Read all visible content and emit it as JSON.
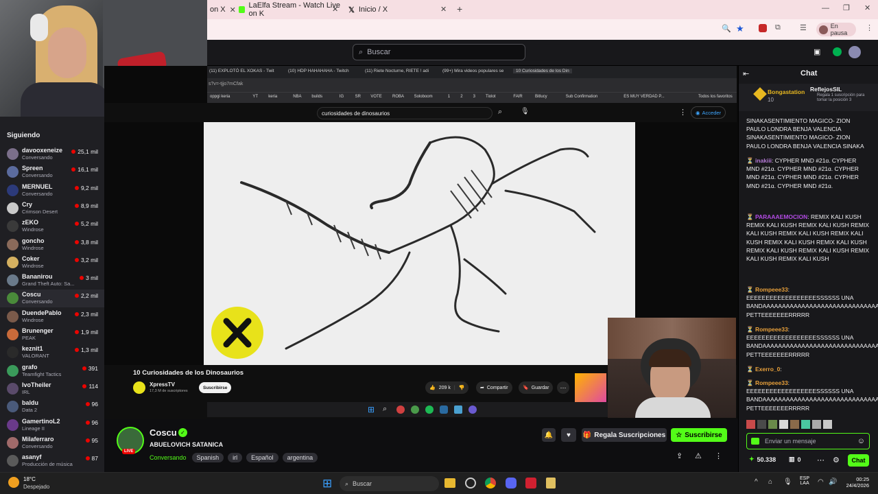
{
  "browser": {
    "tabs": [
      {
        "label": "on X"
      },
      {
        "label": "LaElfa Stream - Watch Live on K"
      },
      {
        "label": "Inicio / X"
      }
    ],
    "profile_label": "En pausa"
  },
  "twitch": {
    "search_placeholder": "Buscar",
    "sidebar_heading": "Siguiendo",
    "followed": [
      {
        "name": "davooxeneize",
        "game": "Conversando",
        "viewers": "25,1 mil",
        "color": "#7b6f8a"
      },
      {
        "name": "Spreen",
        "game": "Conversando",
        "viewers": "16,1 mil",
        "color": "#5b6b9e"
      },
      {
        "name": "MERNUEL",
        "game": "Conversando",
        "viewers": "9,2 mil",
        "color": "#2c3a7a"
      },
      {
        "name": "Cry",
        "game": "Crimson Desert",
        "viewers": "8,9 mil",
        "color": "#c9c9c9"
      },
      {
        "name": "zEKO",
        "game": "Windrose",
        "viewers": "5,2 mil",
        "color": "#3a3a3a"
      },
      {
        "name": "goncho",
        "game": "Windrose",
        "viewers": "3,8 mil",
        "color": "#8a6a5a"
      },
      {
        "name": "Coker",
        "game": "Windrose",
        "viewers": "3,2 mil",
        "color": "#d4b060"
      },
      {
        "name": "Bananirou",
        "game": "Grand Theft Auto: Sa...",
        "viewers": "3 mil",
        "color": "#6a7a8a"
      },
      {
        "name": "Coscu",
        "game": "Conversando",
        "viewers": "2,2 mil",
        "color": "#4a8a3a"
      },
      {
        "name": "DuendePablo",
        "game": "Windrose",
        "viewers": "2,3 mil",
        "color": "#7a5a4a"
      },
      {
        "name": "Brunenger",
        "game": "PEAK",
        "viewers": "1,9 mil",
        "color": "#c86a3a"
      },
      {
        "name": "keznit1",
        "game": "VALORANT",
        "viewers": "1,3 mil",
        "color": "#2a2a2a"
      },
      {
        "name": "grafo",
        "game": "Teamfight Tactics",
        "viewers": "391",
        "color": "#3a9a5a"
      },
      {
        "name": "IvoTheiler",
        "game": "IRL",
        "viewers": "114",
        "color": "#5a4a6a"
      },
      {
        "name": "baldu",
        "game": "Data 2",
        "viewers": "96",
        "color": "#4a5a7a"
      },
      {
        "name": "GamertinoL2",
        "game": "Lineage II",
        "viewers": "96",
        "color": "#6a3a8a"
      },
      {
        "name": "Milaferraro",
        "game": "Conversando",
        "viewers": "95",
        "color": "#a06a6a"
      },
      {
        "name": "asanyf",
        "game": "Producción de música",
        "viewers": "87",
        "color": "#5a5a5a"
      }
    ]
  },
  "stream": {
    "inner_tabs": [
      "(11) EXPLOTÓ EL XOKAS - Twit",
      "(10) HDP HAHAHAHA - Twitch",
      "(11) Riete Nocturne, RIETE ! adi",
      "(99+) Mira videos populares se",
      "10 Curiosidades de los Din"
    ],
    "inner_url": "s?v=-tjjo7mCfak",
    "bookmarks": [
      "oppgi keria",
      "YT",
      "keria",
      "NBA",
      "builds",
      "IG",
      "SR",
      "VOTE",
      "ROBA",
      "Soloboom",
      "1",
      "2",
      "3",
      "Tiolot",
      "FAIR",
      "Bitlucy",
      "Sub Confirmation",
      "ES MUY VERDAD P...",
      "Todos los favoritos"
    ],
    "yt_query": "curiosidades de dinosaurios",
    "yt_signin": "Acceder",
    "video_title": "10 Curiosidades de los Dinosaurios",
    "yt_channel": "XpressTV",
    "yt_subs": "17,3 M de suscriptores",
    "yt_subscribe": "Suscribirse",
    "likes": "209 k",
    "share": "Compartir",
    "save": "Guardar"
  },
  "channel": {
    "name": "Coscu",
    "title": "ABUELOVICH SATANICA",
    "category": "Conversando",
    "tags": [
      "Spanish",
      "irl",
      "Español",
      "argentina"
    ],
    "live_badge": "LIVE",
    "gift_label": "Regala Suscripciones",
    "subscribe_label": "Suscribirse"
  },
  "chat": {
    "header": "Chat",
    "pinned_user": "Bongastation",
    "pinned_count": "10",
    "gift_user": "ReflejosSIL",
    "gift_text": "Regala 1 suscripción para tomar la posición 3",
    "messages": [
      {
        "user": "",
        "color": "#efeff1",
        "text": "SINAKASENTIMIENTO MAGICO- ZION PAULO LONDRA BENJA VALENCIA SINAKASENTIMIENTO MAGICO- ZION PAULO LONDRA BENJA VALENCIA SINAKA"
      },
      {
        "user": "inakiii",
        "color": "#b57ad6",
        "text": "CYPHER MND #21ɑ. CYPHER MND #21ɑ. CYPHER MND #21ɑ. CYPHER MND #21ɑ. CYPHER MND #21ɑ. CYPHER MND #21ɑ. CYPHER MND #21ɑ."
      },
      {
        "user": "PARAAAEMOCION",
        "color": "#b24be3",
        "text": "REMIX KALI KUSH REMIX KALI KUSH REMIX KALI KUSH REMIX KALI KUSH REMIX KALI KUSH REMIX KALI KUSH REMIX KALI KUSH REMIX KALI KUSH REMIX KALI KUSH REMIX KALI KUSH REMIX KALI KUSH REMIX KALI KUSH"
      },
      {
        "user": "Rompeee33",
        "color": "#e8a03b",
        "text": "EEEEEEEEEEEEEEEEEESSSSSS UNA BANDAAAAAAAAAAAAAAAAAAAAAAAAAAAAAA PETTEEEEEEERRRRR"
      },
      {
        "user": "Rompeee33",
        "color": "#e8a03b",
        "text": "EEEEEEEEEEEEEEEEEESSSSSS UNA BANDAAAAAAAAAAAAAAAAAAAAAAAAAAAAAA PETTEEEEEEERRRRR"
      },
      {
        "user": "Exerro_0",
        "color": "#e8a03b",
        "text": ""
      },
      {
        "user": "Rompeee33",
        "color": "#e8a03b",
        "text": "EEEEEEEEEEEEEEEEEESSSSSS UNA BANDAAAAAAAAAAAAAAAAAAAAAAAAAAAAAA PETTEEEEEEERRRRR"
      }
    ],
    "input_placeholder": "Enviar un mensaje",
    "points": "50.338",
    "points2": "0",
    "send_label": "Chat"
  },
  "taskbar": {
    "weather_temp": "18°C",
    "weather_desc": "Despejado",
    "search_placeholder": "Buscar",
    "lang1": "ESP",
    "lang2": "LAA",
    "time": "00:25",
    "date": "24/4/2026"
  }
}
